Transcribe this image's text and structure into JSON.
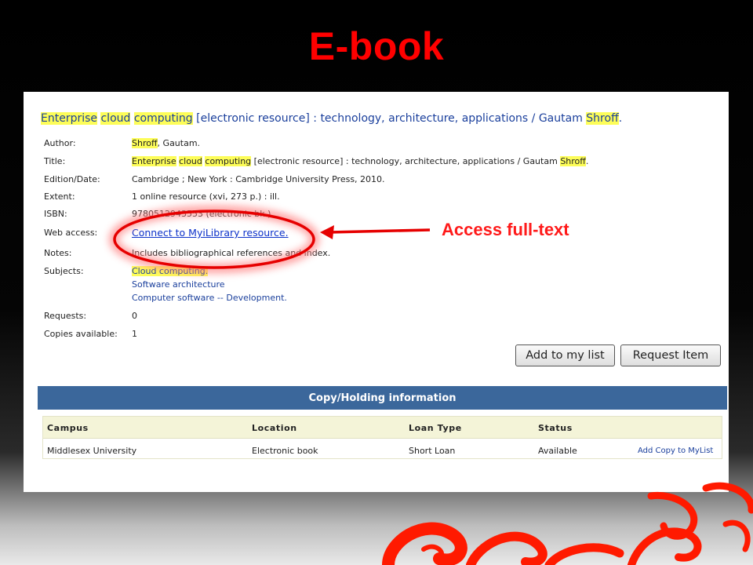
{
  "slide": {
    "title": "E-book",
    "callout": "Access full-text",
    "accent_color": "#ff0000"
  },
  "record": {
    "title_parts": [
      {
        "text": "Enterprise",
        "hl": true
      },
      {
        "text": " ",
        "hl": false
      },
      {
        "text": "cloud",
        "hl": true
      },
      {
        "text": " ",
        "hl": false
      },
      {
        "text": "computing",
        "hl": true
      },
      {
        "text": " [electronic resource] : technology, architecture, applications / Gautam ",
        "hl": false
      },
      {
        "text": "Shroff",
        "hl": true
      },
      {
        "text": ".",
        "hl": false
      }
    ],
    "fields": {
      "author_label": "Author:",
      "author_hl": "Shroff",
      "author_rest": ", Gautam.",
      "title_label": "Title:",
      "title_rest": " [electronic resource] : technology, architecture, applications / Gautam ",
      "title_w1": "Enterprise",
      "title_w2": "cloud",
      "title_w3": "computing",
      "title_w4": "Shroff",
      "title_end": ".",
      "edition_label": "Edition/Date:",
      "edition_value": "Cambridge ; New York : Cambridge University Press, 2010.",
      "extent_label": "Extent:",
      "extent_value": "1 online resource (xvi, 273 p.) : ill.",
      "isbn_label": "ISBN:",
      "isbn_value": "9780512943553 (electronic bk.)",
      "web_label": "Web access:",
      "web_value": "Connect to MyiLibrary resource.",
      "notes_label": "Notes:",
      "notes_value": "Includes bibliographical references and index.",
      "subjects_label": "Subjects:",
      "subjects": [
        "Cloud computing.",
        "Software architecture",
        "Computer software -- Development."
      ],
      "requests_label": "Requests:",
      "requests_value": "0",
      "copies_label": "Copies available:",
      "copies_value": "1"
    },
    "buttons": {
      "add_to_list": "Add to my list",
      "request_item": "Request Item"
    }
  },
  "holdings": {
    "header": "Copy/Holding information",
    "columns": [
      "Campus",
      "Location",
      "Loan Type",
      "Status"
    ],
    "rows": [
      {
        "campus": "Middlesex University",
        "location": "Electronic book",
        "loan_type": "Short Loan",
        "status": "Available",
        "action": "Add Copy to MyList"
      }
    ]
  }
}
